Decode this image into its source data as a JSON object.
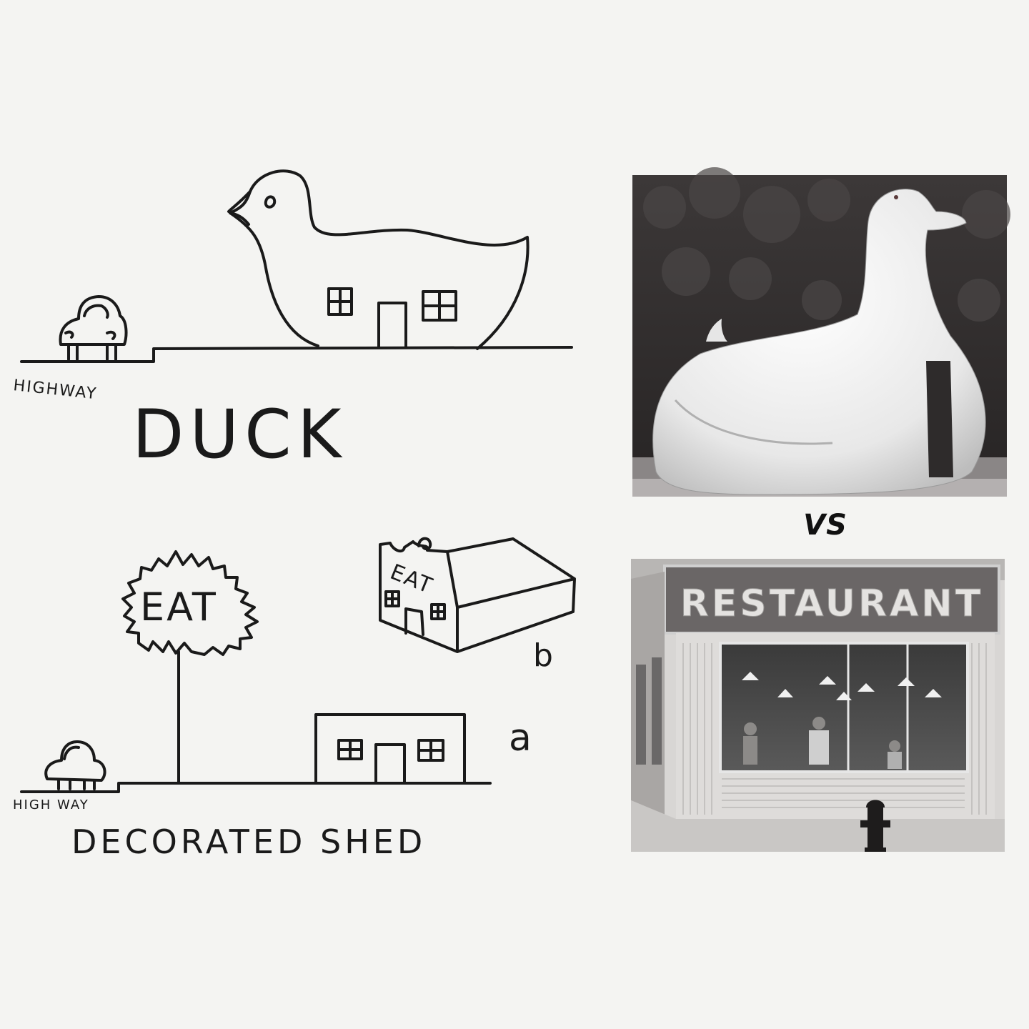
{
  "sketch": {
    "duck_title": "DUCK",
    "duck_highway_label": "HIGHWAY",
    "shed_title": "DECORATED SHED",
    "shed_highway_label": "HIGH WAY",
    "sign_text": "EAT",
    "roof_sign_text": "EAT",
    "label_a": "a",
    "label_b": "b"
  },
  "comparison_label": "VS",
  "photo_restaurant": {
    "sign_text": "RESTAURANT"
  },
  "colors": {
    "background": "#f4f4f2",
    "ink": "#1a1a1a"
  }
}
